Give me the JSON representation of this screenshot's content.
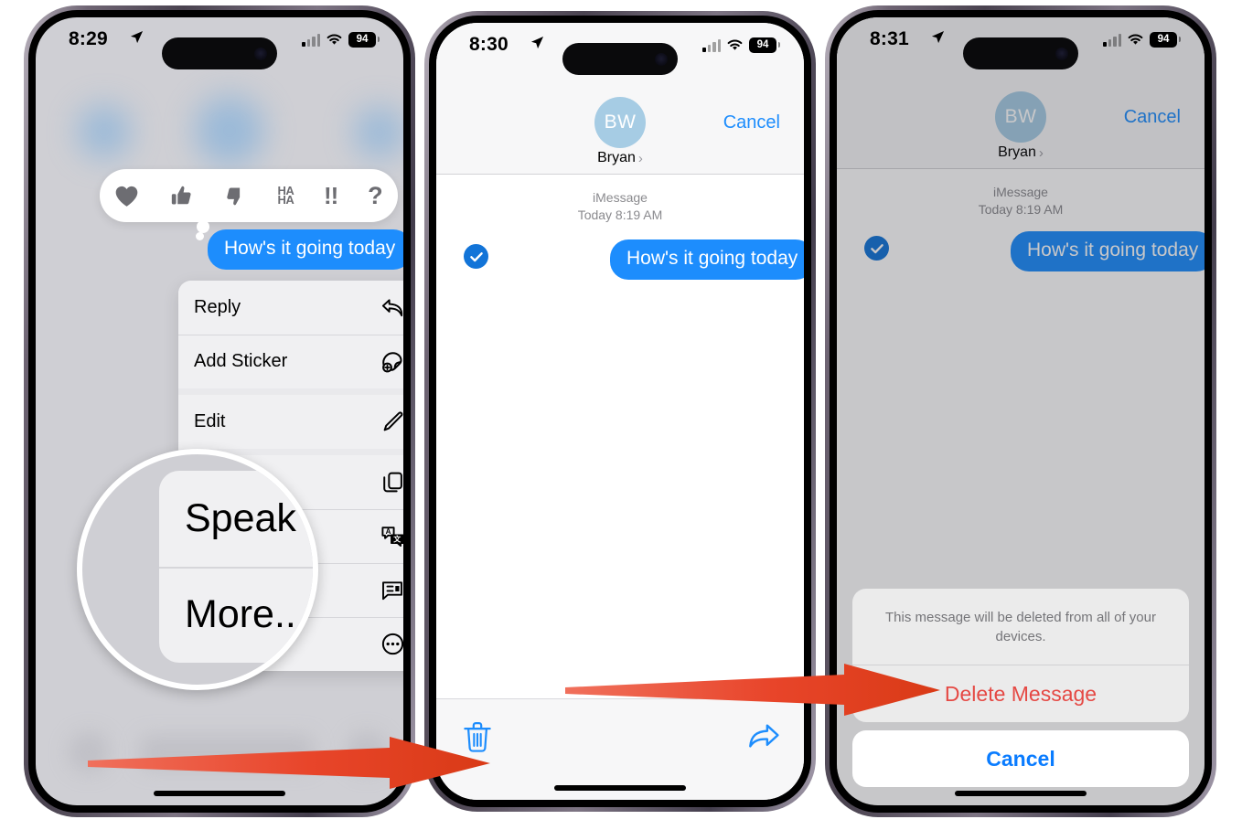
{
  "phones": [
    {
      "id": "phone-1",
      "name": "context-menu-screen",
      "status": {
        "time": "8:29",
        "battery": "94",
        "location_icon": "location-arrow-icon",
        "signal_icon": "cellular-signal-icon",
        "wifi_icon": "wifi-icon"
      },
      "reactions": [
        {
          "name": "heart-reaction",
          "glyph": "heart"
        },
        {
          "name": "thumbs-up-reaction",
          "glyph": "thumbs-up"
        },
        {
          "name": "thumbs-down-reaction",
          "glyph": "thumbs-down"
        },
        {
          "name": "haha-reaction",
          "glyph": "HA",
          "glyph2": "HA"
        },
        {
          "name": "exclamation-reaction",
          "glyph": "!!"
        },
        {
          "name": "question-reaction",
          "glyph": "?"
        }
      ],
      "message": "How's it going today",
      "menu_groups": [
        [
          {
            "label": "Reply",
            "icon": "reply-arrow-icon"
          },
          {
            "label": "Add Sticker",
            "icon": "sticker-icon"
          }
        ],
        [
          {
            "label": "Edit",
            "icon": "pencil-icon"
          }
        ],
        [
          {
            "label": "Copy",
            "icon": "copy-icon"
          },
          {
            "label": "Translate",
            "icon": "translate-icon"
          },
          {
            "label": "Speak",
            "icon": "speak-bubble-icon"
          },
          {
            "label": "More...",
            "icon": "ellipsis-circle-icon"
          }
        ]
      ],
      "magnifier": {
        "rows": [
          "Speak",
          "More..."
        ]
      }
    },
    {
      "id": "phone-2",
      "name": "message-selection-screen",
      "status": {
        "time": "8:30",
        "battery": "94"
      },
      "nav": {
        "avatar_initials": "BW",
        "contact_name": "Bryan",
        "chevron": "›",
        "cancel_label": "Cancel"
      },
      "thread": {
        "service": "iMessage",
        "timestamp": "Today 8:19 AM",
        "message": "How's it going today",
        "selected": true
      },
      "toolbar": {
        "delete_icon": "trash-icon",
        "forward_icon": "forward-arrow-icon"
      }
    },
    {
      "id": "phone-3",
      "name": "delete-confirmation-screen",
      "status": {
        "time": "8:31",
        "battery": "94"
      },
      "nav": {
        "avatar_initials": "BW",
        "contact_name": "Bryan",
        "chevron": "›",
        "cancel_label": "Cancel"
      },
      "thread": {
        "service": "iMessage",
        "timestamp": "Today 8:19 AM",
        "message": "How's it going today",
        "selected": true
      },
      "action_sheet": {
        "message": "This message will be deleted from all of your devices.",
        "destructive_label": "Delete Message",
        "cancel_label": "Cancel"
      }
    }
  ],
  "annotations": {
    "arrow1": {
      "name": "arrow-to-trash-icon"
    },
    "arrow2": {
      "name": "arrow-to-delete-message"
    }
  },
  "colors": {
    "imessage_blue": "#1d8dfd",
    "link_blue": "#0a7cff",
    "destructive_red": "#e8403a",
    "arrow_red": "#de3a1b",
    "avatar_blue": "#a6cce4"
  }
}
